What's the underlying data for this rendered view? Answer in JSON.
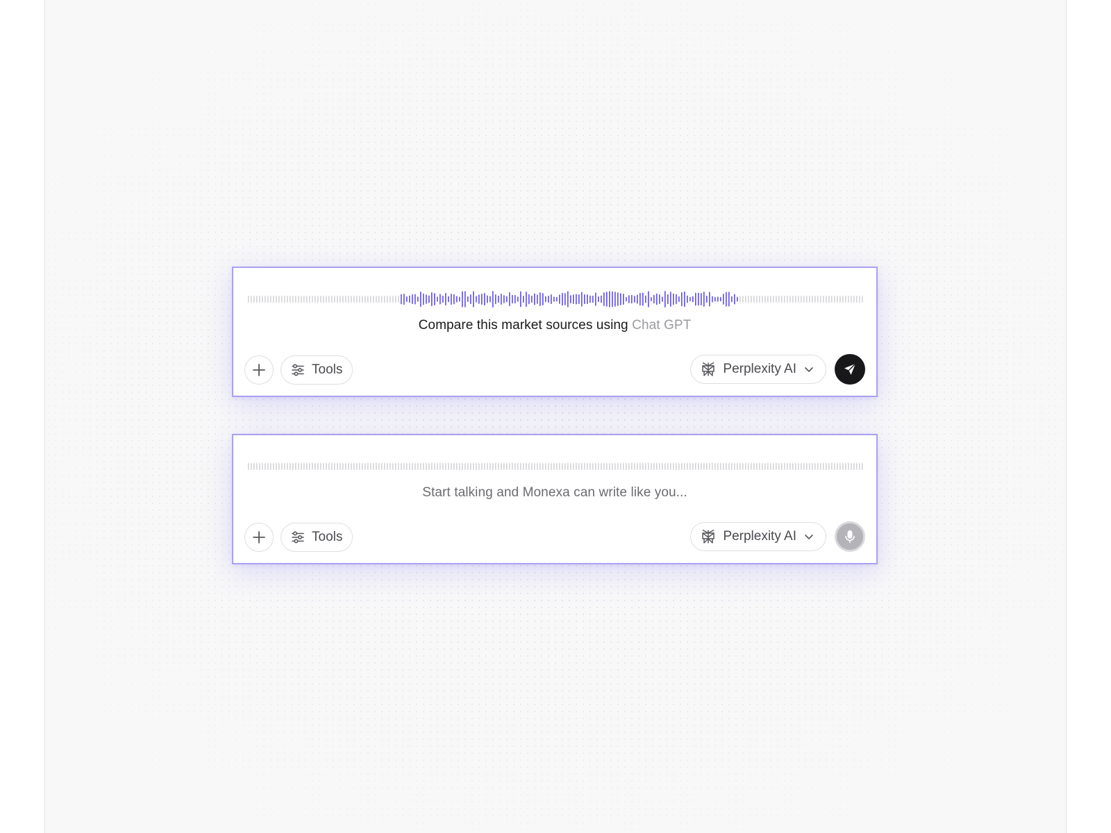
{
  "cards": [
    {
      "state": "recording",
      "prompt_text": "Compare this market sources using",
      "prompt_suffix": "Chat GPT",
      "tools_label": "Tools",
      "model_label": "Perplexity AI",
      "action": "send"
    },
    {
      "state": "idle",
      "placeholder": "Start talking and Monexa can write like you...",
      "tools_label": "Tools",
      "model_label": "Perplexity AI",
      "action": "microphone"
    }
  ],
  "icons": {
    "add": "plus-icon",
    "tools": "sliders-icon",
    "model": "perplexity-logo-icon",
    "dropdown": "chevron-down-icon",
    "send": "paper-plane-icon",
    "mic": "microphone-icon"
  },
  "colors": {
    "accent_border": "#a9a0f2",
    "wave_active": "#5b4cf0",
    "wave_idle": "#d4d4d8",
    "send_bg": "#18181b",
    "mic_bg": "#b3b3b8"
  }
}
